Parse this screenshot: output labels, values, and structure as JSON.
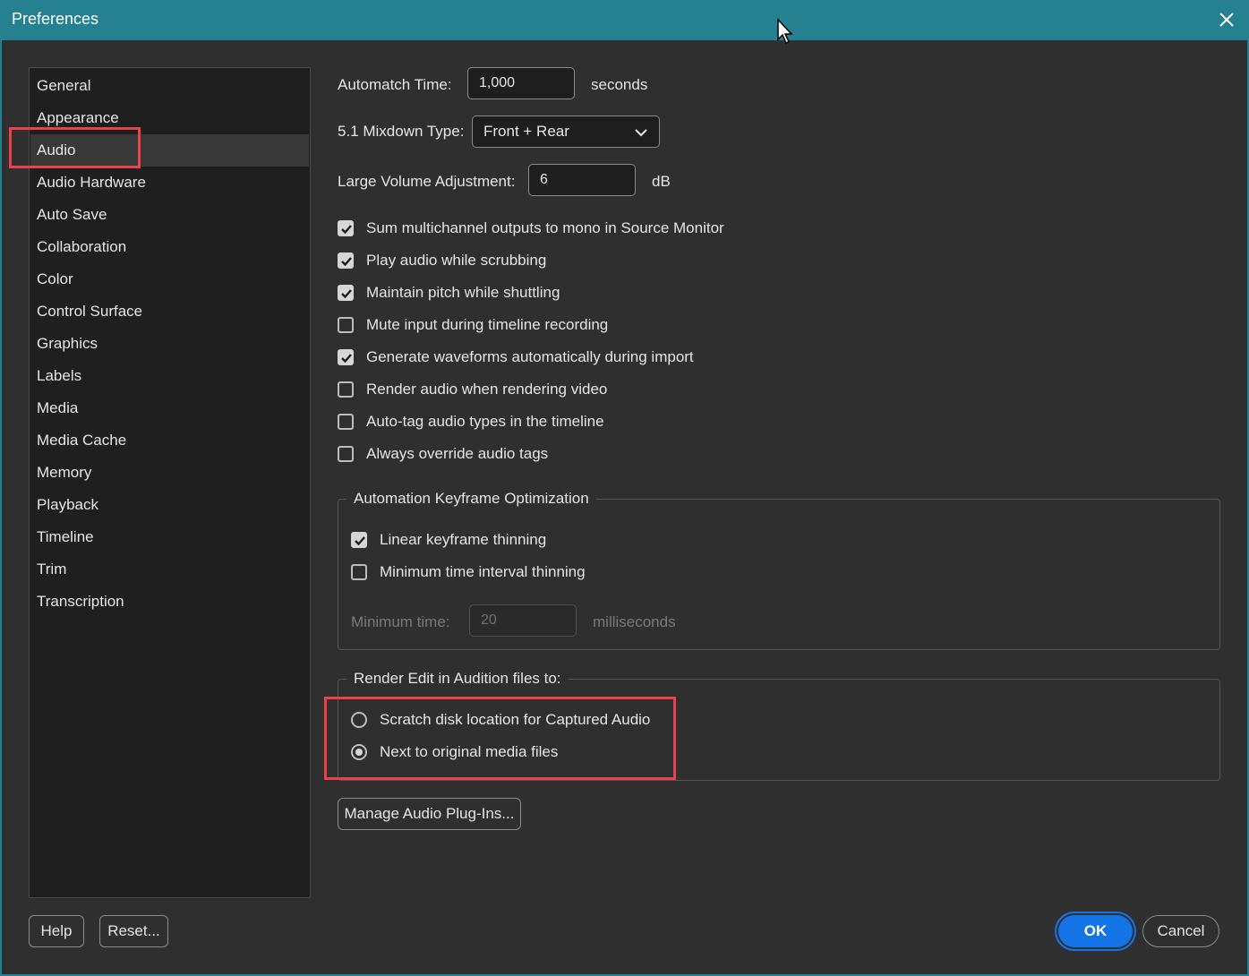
{
  "window": {
    "title": "Preferences"
  },
  "sidebar": {
    "items": [
      {
        "label": "General"
      },
      {
        "label": "Appearance"
      },
      {
        "label": "Audio"
      },
      {
        "label": "Audio Hardware"
      },
      {
        "label": "Auto Save"
      },
      {
        "label": "Collaboration"
      },
      {
        "label": "Color"
      },
      {
        "label": "Control Surface"
      },
      {
        "label": "Graphics"
      },
      {
        "label": "Labels"
      },
      {
        "label": "Media"
      },
      {
        "label": "Media Cache"
      },
      {
        "label": "Memory"
      },
      {
        "label": "Playback"
      },
      {
        "label": "Timeline"
      },
      {
        "label": "Trim"
      },
      {
        "label": "Transcription"
      }
    ],
    "selected": "Audio"
  },
  "audio": {
    "automatch_time": {
      "label": "Automatch Time:",
      "value": "1,000",
      "unit": "seconds"
    },
    "mixdown": {
      "label": "5.1 Mixdown Type:",
      "value": "Front + Rear"
    },
    "large_volume": {
      "label": "Large Volume Adjustment:",
      "value": "6",
      "unit": "dB"
    },
    "checkboxes": [
      {
        "label": "Sum multichannel outputs to mono in Source Monitor",
        "checked": true
      },
      {
        "label": "Play audio while scrubbing",
        "checked": true
      },
      {
        "label": "Maintain pitch while shuttling",
        "checked": true
      },
      {
        "label": "Mute input during timeline recording",
        "checked": false
      },
      {
        "label": "Generate waveforms automatically during import",
        "checked": true
      },
      {
        "label": "Render audio when rendering video",
        "checked": false
      },
      {
        "label": "Auto-tag audio types in the timeline",
        "checked": false
      },
      {
        "label": "Always override audio tags",
        "checked": false
      }
    ],
    "keyframe_optimization": {
      "title": "Automation Keyframe Optimization",
      "options": [
        {
          "label": "Linear keyframe thinning",
          "checked": true
        },
        {
          "label": "Minimum time interval thinning",
          "checked": false
        }
      ],
      "minimum_time": {
        "label": "Minimum time:",
        "value": "20",
        "unit": "milliseconds"
      }
    },
    "render_audition": {
      "title": "Render Edit in Audition files to:",
      "options": [
        {
          "label": "Scratch disk location for Captured Audio",
          "selected": false
        },
        {
          "label": "Next to original media files",
          "selected": true
        }
      ]
    },
    "manage_plugins_label": "Manage Audio Plug-Ins..."
  },
  "footer": {
    "help_label": "Help",
    "reset_label": "Reset...",
    "ok_label": "OK",
    "cancel_label": "Cancel"
  },
  "colors": {
    "titlebar": "#25808f",
    "background": "#2f2f2f",
    "sidebar": "#1f1f1f",
    "highlight_box": "#e8434b",
    "primary_button": "#1473e6"
  }
}
